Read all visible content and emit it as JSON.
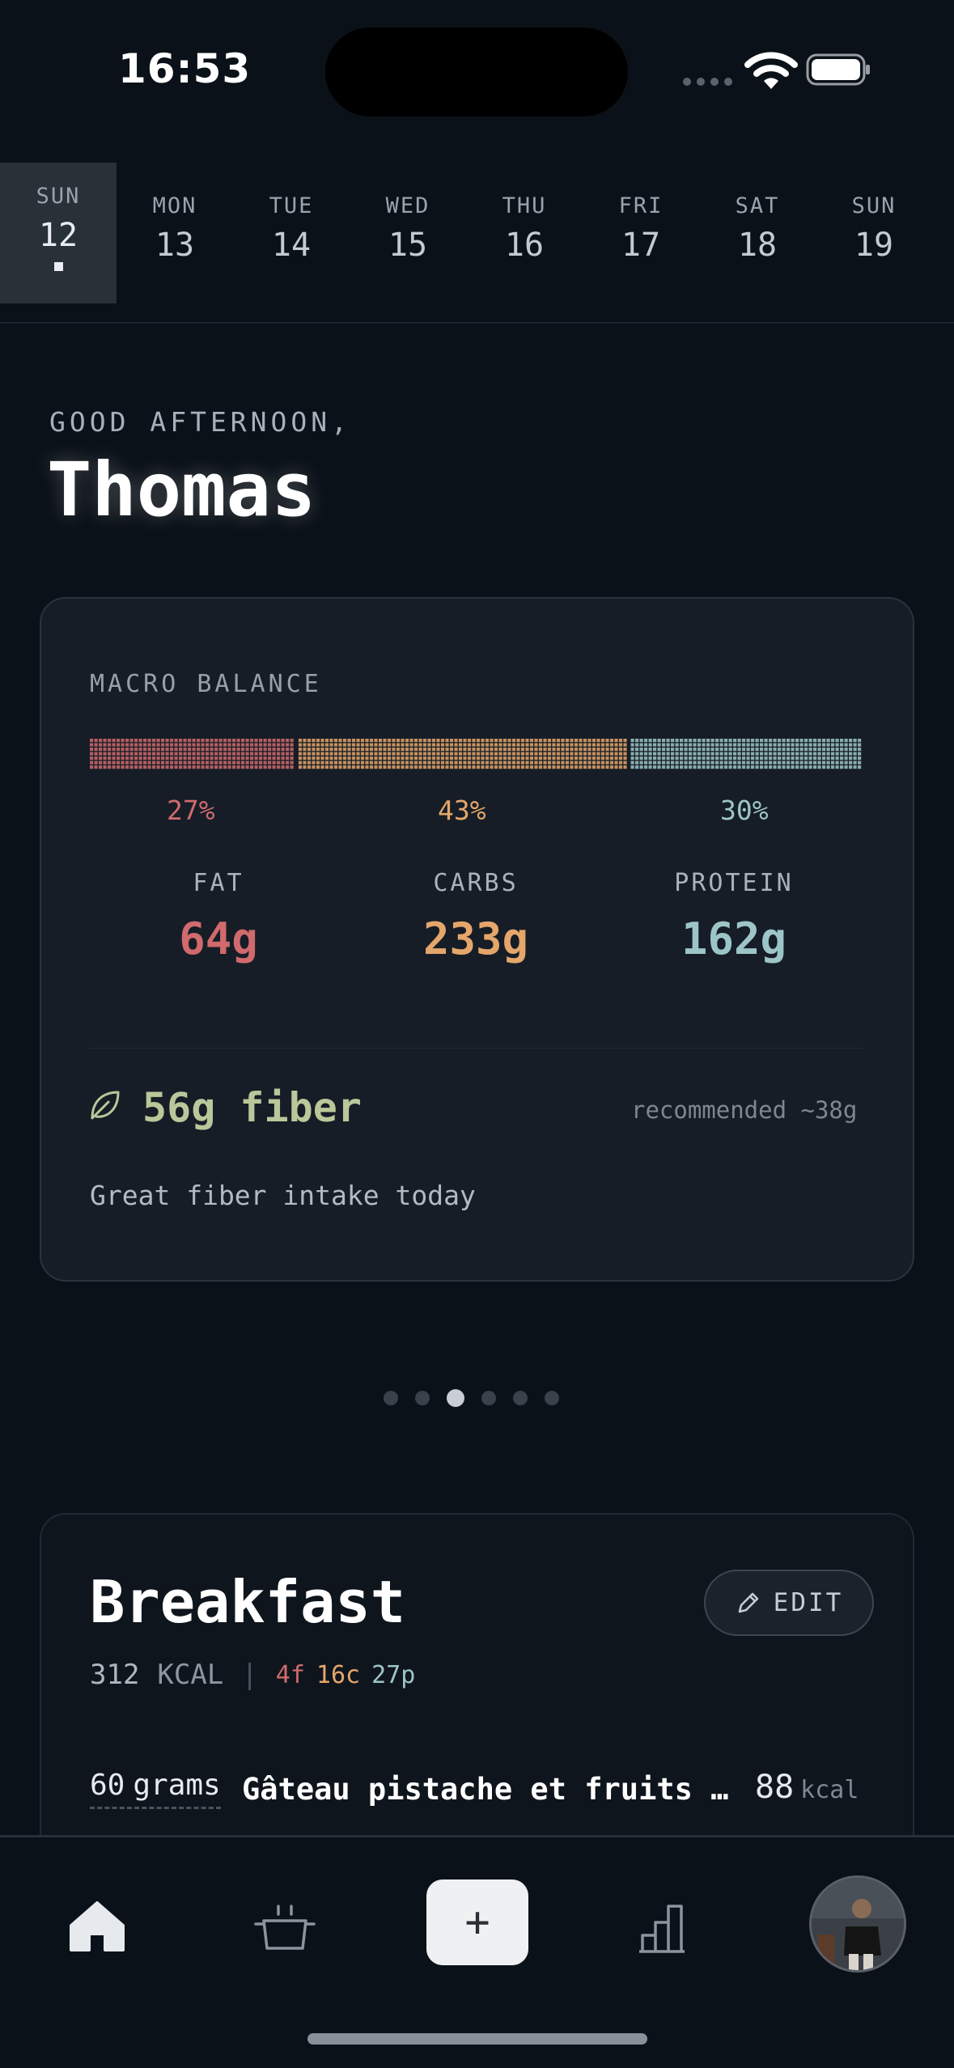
{
  "status_bar": {
    "time": "16:53"
  },
  "date_strip": [
    {
      "day": "SUN",
      "date": "12",
      "active": true
    },
    {
      "day": "MON",
      "date": "13"
    },
    {
      "day": "TUE",
      "date": "14"
    },
    {
      "day": "WED",
      "date": "15"
    },
    {
      "day": "THU",
      "date": "16"
    },
    {
      "day": "FRI",
      "date": "17"
    },
    {
      "day": "SAT",
      "date": "18"
    },
    {
      "day": "SUN",
      "date": "19"
    }
  ],
  "greeting": {
    "line": "GOOD AFTERNOON,",
    "name": "Thomas"
  },
  "macro_card": {
    "label": "MACRO BALANCE",
    "fat": {
      "pct": "27%",
      "label": "FAT",
      "value": "64g",
      "color": "#d06a6d"
    },
    "carbs": {
      "pct": "43%",
      "label": "CARBS",
      "value": "233g",
      "color": "#e4a66a"
    },
    "protein": {
      "pct": "30%",
      "label": "PROTEIN",
      "value": "162g",
      "color": "#9dc5c7"
    },
    "fiber": "56g fiber",
    "recommended": "recommended ~38g",
    "note": "Great fiber intake today"
  },
  "pager": {
    "count": 6,
    "active": 2
  },
  "breakfast": {
    "title": "Breakfast",
    "edit": "EDIT",
    "kcal_value": "312",
    "kcal_unit": "KCAL",
    "fat": "4f",
    "carbs": "16c",
    "protein": "27p",
    "items": [
      {
        "qty": "60",
        "unit": "grams",
        "name": "Gâteau pistache et fruits rouges",
        "kcal": "88",
        "kcal_unit": "kcal"
      }
    ]
  },
  "tab_bar": {
    "add": "+",
    "icons": [
      "home-icon",
      "pot-icon",
      "add-icon",
      "stats-icon",
      "avatar"
    ]
  }
}
